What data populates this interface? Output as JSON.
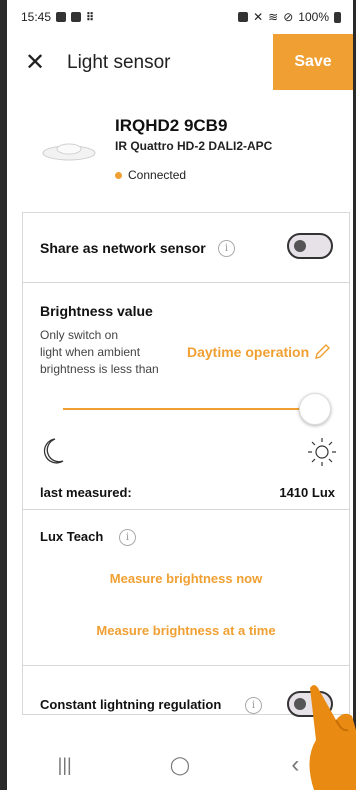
{
  "status_bar": {
    "time": "15:45",
    "battery": "100%",
    "left_icons": [
      "gallery-icon",
      "notification-icon",
      "grid-dots-icon"
    ],
    "right_icons": [
      "lock-icon",
      "mute-icon",
      "wifi-icon",
      "do-not-disturb-icon",
      "battery-icon"
    ]
  },
  "header": {
    "close_icon": "close-icon",
    "title": "Light sensor",
    "save_label": "Save"
  },
  "device": {
    "name": "IRQHD2 9CB9",
    "model": "IR Quattro HD-2 DALI2-APC",
    "status": "Connected",
    "status_color": "#f0a032"
  },
  "share": {
    "label": "Share as network sensor",
    "toggle_on": false
  },
  "brightness": {
    "title": "Brightness value",
    "description_line1": "Only switch on",
    "description_line2": "light when ambient",
    "description_line3": "brightness is less than",
    "mode_label": "Daytime operation",
    "slider_value": 1.0,
    "last_measured_label": "last measured:",
    "last_measured_value": "1410 Lux"
  },
  "lux_teach": {
    "title": "Lux Teach",
    "measure_now": "Measure brightness now",
    "measure_at_time": "Measure brightness at a time"
  },
  "constant": {
    "label": "Constant lightning regulation",
    "toggle_on": false
  },
  "nav": {
    "recents": "|||",
    "home": "◯",
    "back": "‹"
  },
  "colors": {
    "accent": "#f0a032",
    "text": "#111111",
    "border": "#d8d8d8"
  }
}
